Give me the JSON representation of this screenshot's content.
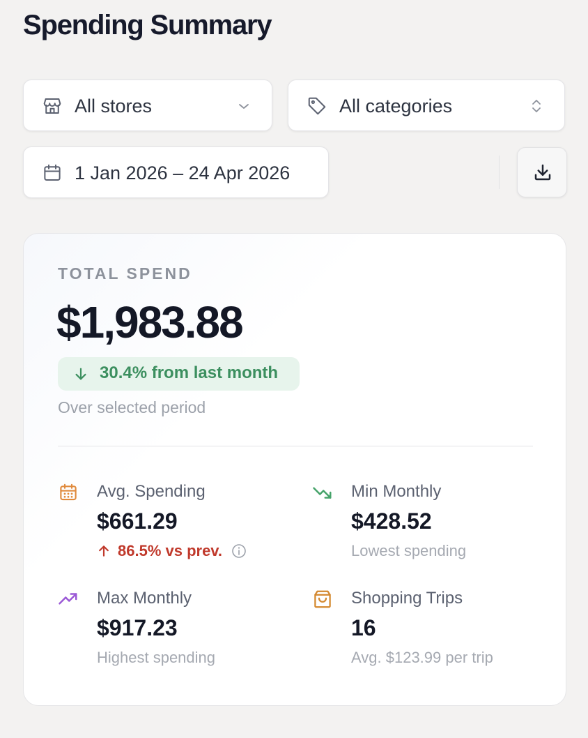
{
  "page": {
    "title": "Spending Summary"
  },
  "filters": {
    "store": {
      "value": "All stores",
      "icon": "store-icon",
      "control_icon": "chevron-down-icon"
    },
    "category": {
      "value": "All categories",
      "icon": "tag-icon",
      "control_icon": "chevron-up-down-icon"
    },
    "date_range": {
      "value": "1 Jan 2026 – 24 Apr 2026",
      "icon": "calendar-icon"
    },
    "download_icon": "download-icon"
  },
  "summary": {
    "eyebrow": "TOTAL SPEND",
    "total": "$1,983.88",
    "change": {
      "text": "30.4% from last month",
      "direction": "down",
      "color": "#3c8f5f"
    },
    "period": "Over selected period"
  },
  "stats": [
    {
      "id": "avg",
      "icon": "calendar-grid-icon",
      "icon_color": "#e08a3c",
      "label": "Avg. Spending",
      "value": "$661.29",
      "delta": "86.5% vs prev.",
      "delta_direction": "up",
      "delta_color": "#c0392b"
    },
    {
      "id": "min",
      "icon": "trend-down-icon",
      "icon_color": "#46a36a",
      "label": "Min Monthly",
      "value": "$428.52",
      "sub": "Lowest spending"
    },
    {
      "id": "max",
      "icon": "trend-up-icon",
      "icon_color": "#9b59d6",
      "label": "Max Monthly",
      "value": "$917.23",
      "sub": "Highest spending"
    },
    {
      "id": "trips",
      "icon": "shopping-bag-icon",
      "icon_color": "#d4882f",
      "label": "Shopping Trips",
      "value": "16",
      "sub": "Avg. $123.99 per trip"
    }
  ]
}
